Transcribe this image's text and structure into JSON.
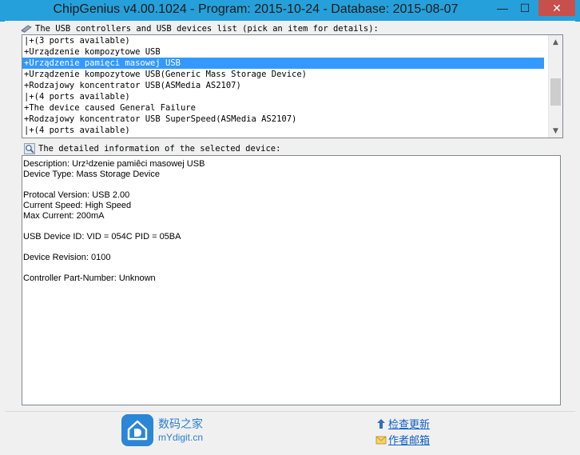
{
  "window": {
    "title": "ChipGenius v4.00.1024 - Program: 2015-10-24 - Database: 2015-08-07",
    "minimize_label": "—",
    "maximize_label": "☐",
    "close_label": "✕"
  },
  "usb_list": {
    "label": "The USB controllers and USB devices list (pick an item for details):",
    "selected_index": 2,
    "items": [
      "|+(3 ports available)",
      "+Urządzenie kompozytowe USB",
      "+Urządzenie pamięci masowej USB",
      "+Urządzenie kompozytowe USB(Generic Mass Storage Device)",
      "+Rodzajowy koncentrator USB(ASMedia AS2107)",
      "|+(4 ports available)",
      "+The device caused General Failure",
      "+Rodzajowy koncentrator USB SuperSpeed(ASMedia AS2107)",
      "|+(4 ports available)"
    ]
  },
  "details": {
    "label": "The detailed information of the selected device:",
    "lines": [
      "Description: Urz¹dzenie pamiêci masowej USB",
      "Device Type: Mass Storage Device",
      "",
      "Protocal Version: USB 2.00",
      "Current Speed: High Speed",
      "Max Current: 200mA",
      "",
      "USB Device ID: VID = 054C PID = 05BA",
      "",
      "Device Revision: 0100",
      "",
      "Controller Part-Number: Unknown"
    ]
  },
  "footer": {
    "logo_cn": "数码之家",
    "logo_en": "mYdigit.cn",
    "check_update": "检查更新",
    "author_mail": "作者邮箱"
  },
  "colors": {
    "titlebar": "#26a0da",
    "selection": "#3399ff",
    "close_button": "#c7504c",
    "link": "#0f5fc8"
  }
}
